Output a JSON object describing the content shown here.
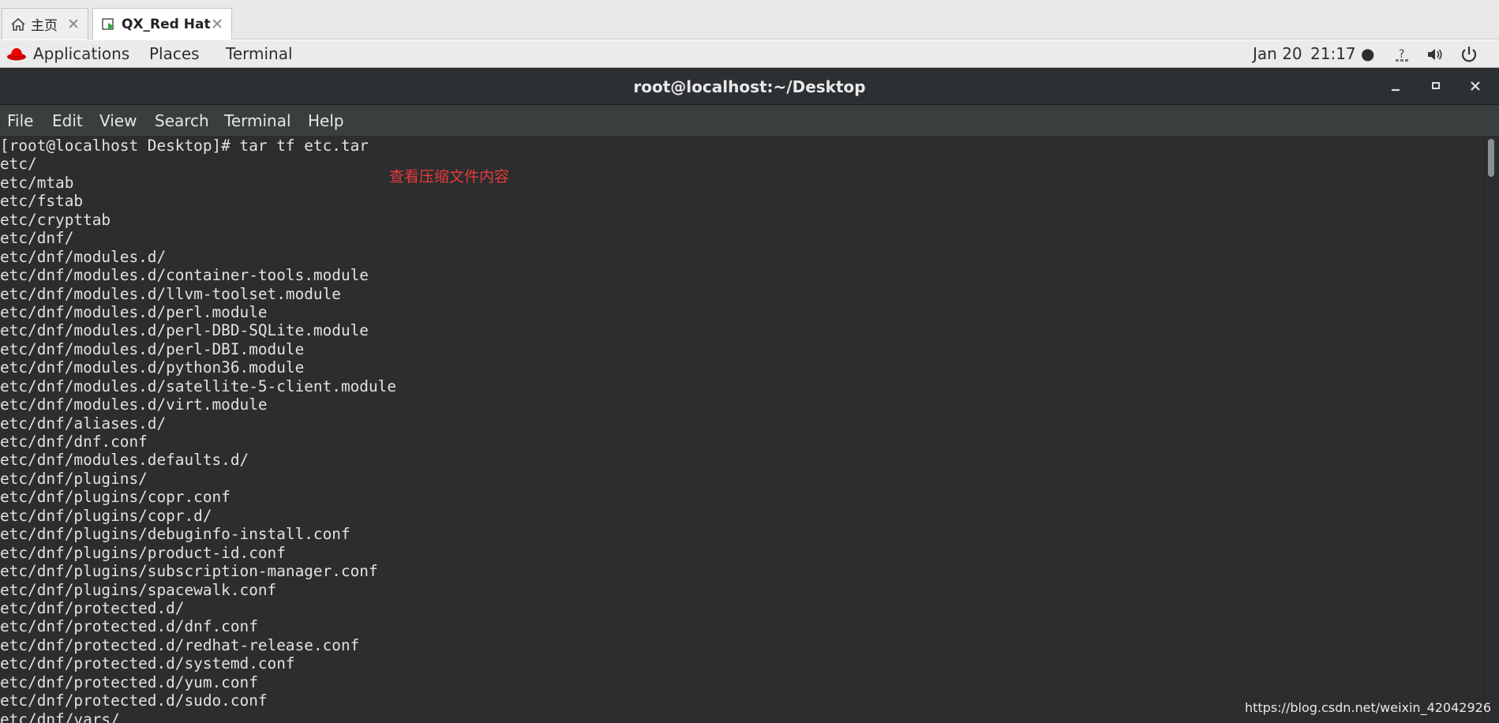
{
  "vm_tabs": [
    {
      "label": "主页",
      "icon": "home-icon"
    },
    {
      "label": "QX_Red Hat",
      "icon": "vm-console-icon"
    }
  ],
  "topbar": {
    "applications": "Applications",
    "places": "Places",
    "terminal": "Terminal",
    "date": "Jan 20",
    "time": "21:17 ●",
    "icons": [
      "network-question-icon",
      "volume-icon",
      "power-icon"
    ]
  },
  "window": {
    "title": "root@localhost:~/Desktop",
    "controls": [
      "minimize-icon",
      "maximize-icon",
      "close-icon"
    ]
  },
  "menubar": {
    "file": "File",
    "edit": "Edit",
    "view": "View",
    "search": "Search",
    "terminal": "Terminal",
    "help": "Help"
  },
  "terminal": {
    "lines": [
      "[root@localhost Desktop]# tar tf etc.tar",
      "etc/",
      "etc/mtab",
      "etc/fstab",
      "etc/crypttab",
      "etc/dnf/",
      "etc/dnf/modules.d/",
      "etc/dnf/modules.d/container-tools.module",
      "etc/dnf/modules.d/llvm-toolset.module",
      "etc/dnf/modules.d/perl.module",
      "etc/dnf/modules.d/perl-DBD-SQLite.module",
      "etc/dnf/modules.d/perl-DBI.module",
      "etc/dnf/modules.d/python36.module",
      "etc/dnf/modules.d/satellite-5-client.module",
      "etc/dnf/modules.d/virt.module",
      "etc/dnf/aliases.d/",
      "etc/dnf/dnf.conf",
      "etc/dnf/modules.defaults.d/",
      "etc/dnf/plugins/",
      "etc/dnf/plugins/copr.conf",
      "etc/dnf/plugins/copr.d/",
      "etc/dnf/plugins/debuginfo-install.conf",
      "etc/dnf/plugins/product-id.conf",
      "etc/dnf/plugins/subscription-manager.conf",
      "etc/dnf/plugins/spacewalk.conf",
      "etc/dnf/protected.d/",
      "etc/dnf/protected.d/dnf.conf",
      "etc/dnf/protected.d/redhat-release.conf",
      "etc/dnf/protected.d/systemd.conf",
      "etc/dnf/protected.d/yum.conf",
      "etc/dnf/protected.d/sudo.conf",
      "etc/dnf/vars/"
    ],
    "annotation": "查看压缩文件内容"
  },
  "watermark": "https://blog.csdn.net/weixin_42042926"
}
